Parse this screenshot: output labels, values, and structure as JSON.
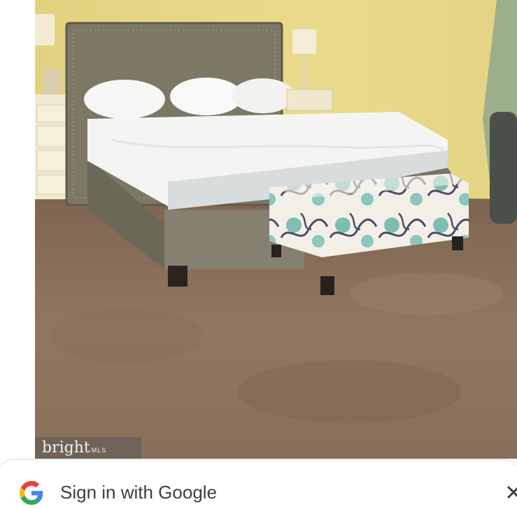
{
  "listing_photo": {
    "watermark_main": "bright",
    "watermark_sub": "MLS"
  },
  "signin_prompt": {
    "label": "Sign in with Google",
    "logo_icon": "google-g-icon",
    "close_icon": "close-icon"
  },
  "colors": {
    "wall": "#e7d786",
    "carpet": "#8e7459",
    "google_blue": "#4285F4",
    "google_red": "#EA4335",
    "google_yellow": "#FBBC05",
    "google_green": "#34A853"
  }
}
